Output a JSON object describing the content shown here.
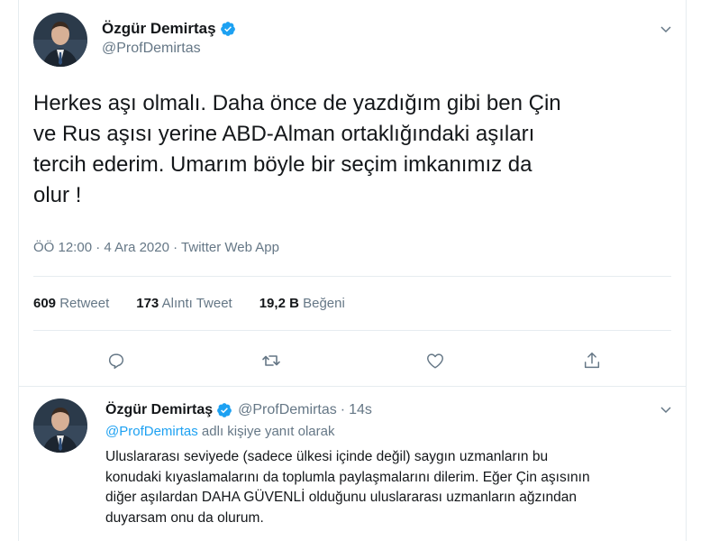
{
  "tweet": {
    "author_name": "Özgür Demirtaş",
    "handle": "@ProfDemirtas",
    "text_lines": [
      "Herkes aşı olmalı. Daha önce de yazdığım gibi ben Çin",
      "ve Rus aşısı yerine ABD-Alman ortaklığındaki aşıları",
      "tercih ederim. Umarım böyle bir seçim imkanımız da",
      "olur !"
    ],
    "time": "ÖÖ 12:00",
    "date": "4 Ara 2020",
    "source": "Twitter Web App",
    "separator": "·",
    "stats": {
      "retweets_count": "609",
      "retweets_label": "Retweet",
      "quotes_count": "173",
      "quotes_label": "Alıntı Tweet",
      "likes_count": "19,2 B",
      "likes_label": "Beğeni"
    }
  },
  "reply": {
    "author_name": "Özgür Demirtaş",
    "handle": "@ProfDemirtas",
    "separator": "·",
    "age": "14s",
    "replying_mention": "@ProfDemirtas",
    "replying_suffix": "adlı kişiye yanıt olarak",
    "text_lines": [
      "Uluslararası seviyede (sadece ülkesi içinde değil) saygın uzmanların bu",
      "konudaki kıyaslamalarını da toplumla paylaşmalarını dilerim. Eğer Çin aşısının",
      "diğer aşılardan DAHA GÜVENLİ olduğunu uluslararası uzmanların ağzından",
      "duyarsam onu da olurum."
    ]
  },
  "icons": {
    "verified": "verified-badge-icon",
    "more": "chevron-down-icon",
    "reply": "reply-icon",
    "retweet": "retweet-icon",
    "like": "heart-icon",
    "share": "share-icon"
  },
  "colors": {
    "accent": "#1da1f2",
    "secondary_text": "#657786",
    "primary_text": "#14171a",
    "divider": "#e6ecf0"
  }
}
